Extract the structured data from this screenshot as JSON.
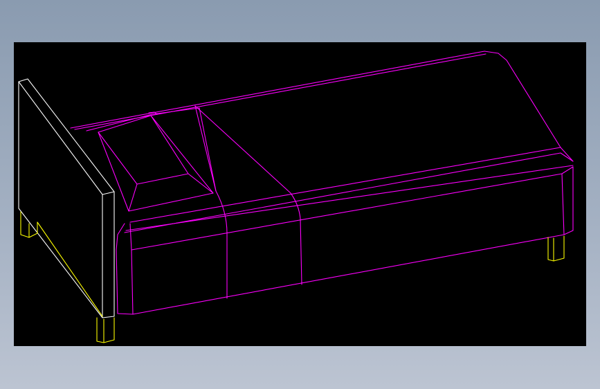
{
  "colors": {
    "background_gradient_top": "#8a9bb0",
    "background_gradient_bottom": "#bcc4d2",
    "viewport_background": "#000000",
    "mattress_wire": "#ff00ff",
    "headboard_wire": "#ffffff",
    "legs_wire": "#ffff00"
  },
  "drawing": {
    "subject": "bed",
    "style": "wireframe",
    "parts": [
      "headboard",
      "pillow",
      "mattress",
      "blanket-band",
      "legs"
    ]
  }
}
